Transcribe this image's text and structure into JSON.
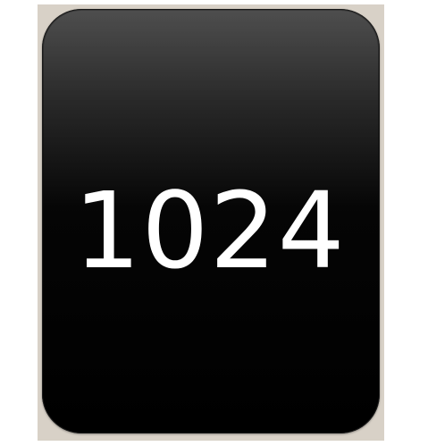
{
  "tile": {
    "value": "1024",
    "background_color": "#000000",
    "text_color": "#ffffff",
    "frame_color": "#d8d1c7"
  }
}
